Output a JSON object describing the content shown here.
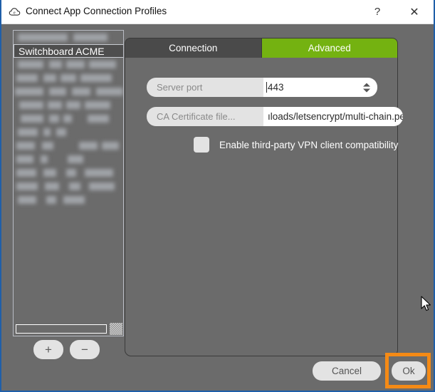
{
  "window": {
    "title": "Connect App Connection Profiles",
    "icon": "cloud-e-icon",
    "help_label": "?",
    "close_label": "✕",
    "border_color": "#1f5fa9"
  },
  "profile_list": {
    "selected_item": "Switchboard ACME",
    "redacted_item_count": 13,
    "add_label": "+",
    "remove_label": "−"
  },
  "tabs": [
    {
      "label": "Connection",
      "active": false
    },
    {
      "label": "Advanced",
      "active": true,
      "color": "#74b211"
    }
  ],
  "advanced": {
    "server_port": {
      "label": "Server port",
      "value": "443",
      "placeholder": "443"
    },
    "ca_certificate": {
      "label": "CA Certificate file...",
      "value": "ıloads/letsencrypt/multi-chain.pem",
      "placeholder": "CA Certificate file..."
    },
    "third_party_vpn": {
      "label": "Enable third-party VPN client compatibility",
      "checked": false
    }
  },
  "footer": {
    "cancel_label": "Cancel",
    "ok_label": "Ok",
    "highlight_color": "#f58a15"
  }
}
